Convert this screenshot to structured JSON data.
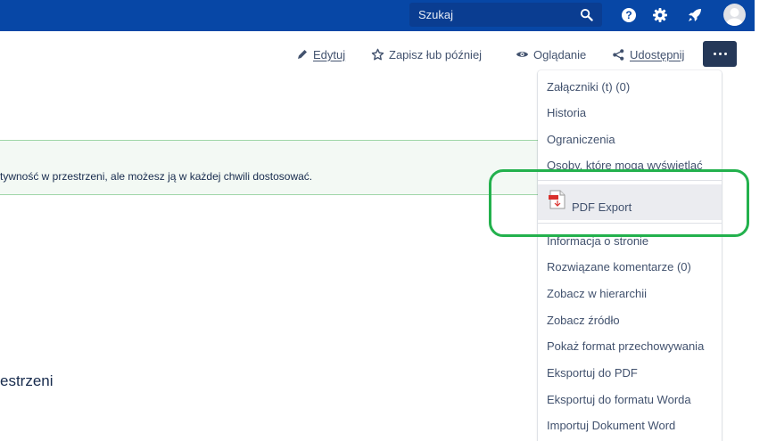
{
  "topbar": {
    "background": "#0747a6",
    "search": {
      "placeholder": "Szukaj"
    },
    "icons": [
      "search-icon",
      "help-icon",
      "gear-icon",
      "rocket-icon",
      "avatar-icon"
    ]
  },
  "toolbar": {
    "edit": {
      "label": "Edytuj",
      "icon": "pencil-icon"
    },
    "save_later": {
      "label": "Zapisz łub później",
      "icon": "star-icon"
    },
    "watch": {
      "label": "Oglądanie",
      "icon": "eye-icon"
    },
    "share": {
      "label": "Udostępnij",
      "icon": "share-icon"
    },
    "more": {
      "icon": "more-icon"
    }
  },
  "content": {
    "banner_text": "tywność w przestrzeni, ale możesz ją w każdej chwili dostosować.",
    "banner_color": "#f3f9f4",
    "section_text": "estrzeni"
  },
  "menu": {
    "items_top": [
      "Załączniki (t) (0)",
      "Historia",
      "Ograniczenia",
      "Osoby, które mogą wyświetlać"
    ],
    "pdf_export": {
      "label": "PDF Export",
      "icon": "pdf-icon"
    },
    "items_bottom": [
      "Informacja o stronie",
      "Rozwiązane komentarze (0)",
      "Zobacz w hierarchii",
      "Zobacz źródło",
      "Pokaż format przechowywania",
      "Eksportuj do PDF",
      "Eksportuj do formatu Worda",
      "Importuj Dokument Word"
    ]
  },
  "highlight": {
    "color": "#23b14d"
  }
}
